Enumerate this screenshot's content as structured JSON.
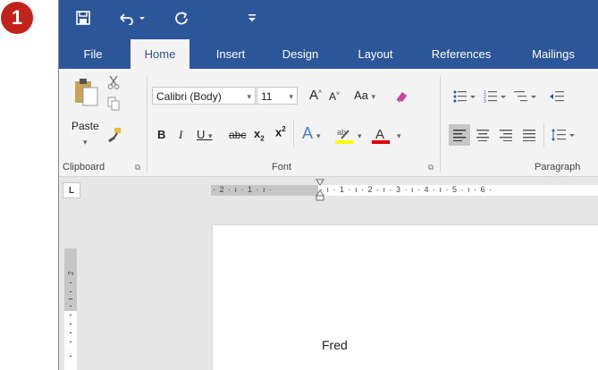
{
  "step_badge": "1",
  "qat": {
    "save_icon": "save-icon",
    "undo_icon": "undo-icon",
    "redo_icon": "redo-icon",
    "customize_icon": "customize-qat-icon"
  },
  "tabs": [
    "File",
    "Home",
    "Insert",
    "Design",
    "Layout",
    "References",
    "Mailings"
  ],
  "clipboard": {
    "paste_label": "Paste",
    "group_label": "Clipboard"
  },
  "font": {
    "name": "Calibri (Body)",
    "size": "11",
    "change_case": "Aa",
    "group_label": "Font"
  },
  "paragraph": {
    "group_label": "Paragraph"
  },
  "ruler": {
    "left_marks": "· 2 · ı · 1 · ı ·",
    "right_marks": "· ı · 1 · ı · 2 · ı · 3 · ı · 4 · ı · 5 · ı · 6 ·",
    "tab_selector": "L"
  },
  "document": {
    "text": "Fred"
  },
  "colors": {
    "accent": "#2b579a",
    "badge": "#c3211a",
    "highlight": "#ffff00",
    "font_color": "#e00000"
  }
}
